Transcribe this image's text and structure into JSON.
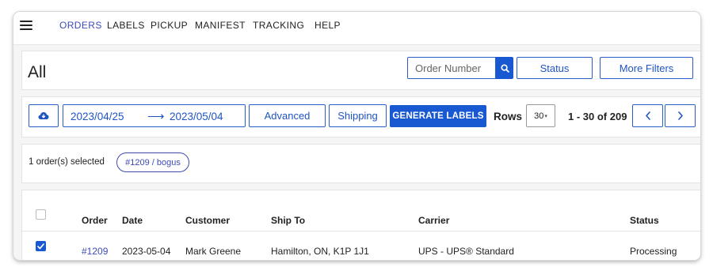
{
  "nav": {
    "items": [
      "ORDERS",
      "LABELS",
      "PICKUP",
      "MANIFEST",
      "TRACKING",
      "HELP"
    ]
  },
  "header": {
    "title": "All",
    "order_number_placeholder": "Order Number",
    "status_label": "Status",
    "more_filters_label": "More Filters"
  },
  "toolbar": {
    "date_from": "2023/04/25",
    "date_arrow": "⟶",
    "date_to": "2023/05/04",
    "advanced_label": "Advanced",
    "shipping_label": "Shipping",
    "generate_labels": "GENERATE LABELS",
    "rows_label": "Rows",
    "rows_value": "30",
    "pagination": "1 - 30 of 209"
  },
  "selection": {
    "text": "1 order(s) selected",
    "chip": "#1209 / bogus"
  },
  "table": {
    "headers": [
      "Order",
      "Date",
      "Customer",
      "Ship To",
      "Carrier",
      "Status"
    ],
    "rows": [
      {
        "checked": true,
        "order": "#1209",
        "date": "2023-05-04",
        "customer": "Mark Greene",
        "ship_to": "Hamilton, ON, K1P 1J1",
        "carrier": "UPS - UPS® Standard",
        "status": "Processing"
      }
    ]
  },
  "colors": {
    "accent": "#1859d1",
    "nav_active": "#3d4bb5",
    "border": "#2a5ec7"
  }
}
